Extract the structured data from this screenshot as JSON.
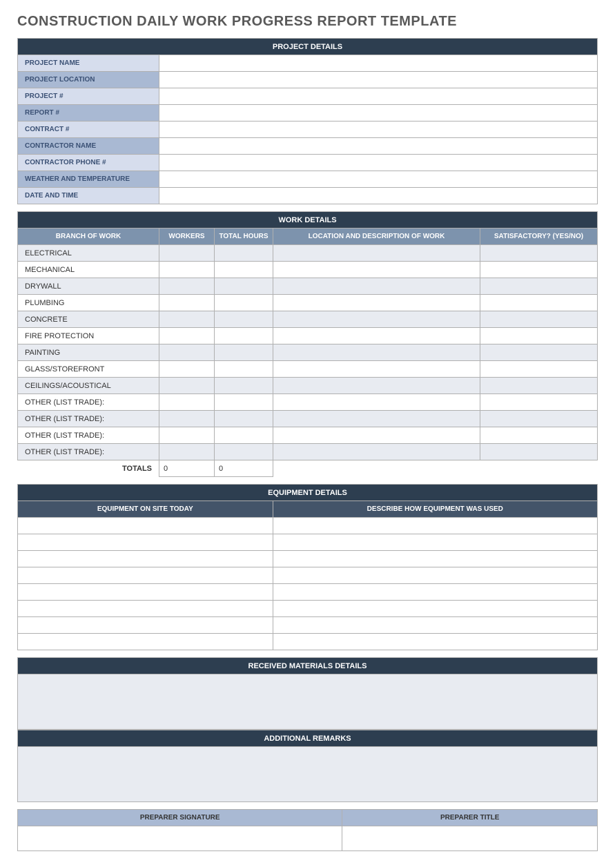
{
  "title": "CONSTRUCTION DAILY WORK PROGRESS REPORT TEMPLATE",
  "sections": {
    "project_details": {
      "header": "PROJECT DETAILS",
      "rows": [
        {
          "label": "PROJECT NAME",
          "value": ""
        },
        {
          "label": "PROJECT LOCATION",
          "value": ""
        },
        {
          "label": "PROJECT #",
          "value": ""
        },
        {
          "label": "REPORT #",
          "value": ""
        },
        {
          "label": "CONTRACT #",
          "value": ""
        },
        {
          "label": "CONTRACTOR NAME",
          "value": ""
        },
        {
          "label": "CONTRACTOR PHONE #",
          "value": ""
        },
        {
          "label": "WEATHER AND TEMPERATURE",
          "value": ""
        },
        {
          "label": "DATE AND TIME",
          "value": ""
        }
      ]
    },
    "work_details": {
      "header": "WORK DETAILS",
      "columns": [
        "BRANCH OF WORK",
        "WORKERS",
        "TOTAL HOURS",
        "LOCATION AND DESCRIPTION OF WORK",
        "SATISFACTORY? (YES/NO)"
      ],
      "rows": [
        {
          "branch": "ELECTRICAL",
          "workers": "",
          "hours": "",
          "location": "",
          "satisfactory": ""
        },
        {
          "branch": "MECHANICAL",
          "workers": "",
          "hours": "",
          "location": "",
          "satisfactory": ""
        },
        {
          "branch": "DRYWALL",
          "workers": "",
          "hours": "",
          "location": "",
          "satisfactory": ""
        },
        {
          "branch": "PLUMBING",
          "workers": "",
          "hours": "",
          "location": "",
          "satisfactory": ""
        },
        {
          "branch": "CONCRETE",
          "workers": "",
          "hours": "",
          "location": "",
          "satisfactory": ""
        },
        {
          "branch": "FIRE PROTECTION",
          "workers": "",
          "hours": "",
          "location": "",
          "satisfactory": ""
        },
        {
          "branch": "PAINTING",
          "workers": "",
          "hours": "",
          "location": "",
          "satisfactory": ""
        },
        {
          "branch": "GLASS/STOREFRONT",
          "workers": "",
          "hours": "",
          "location": "",
          "satisfactory": ""
        },
        {
          "branch": "CEILINGS/ACOUSTICAL",
          "workers": "",
          "hours": "",
          "location": "",
          "satisfactory": ""
        },
        {
          "branch": "OTHER (LIST TRADE):",
          "workers": "",
          "hours": "",
          "location": "",
          "satisfactory": ""
        },
        {
          "branch": "OTHER (LIST TRADE):",
          "workers": "",
          "hours": "",
          "location": "",
          "satisfactory": ""
        },
        {
          "branch": "OTHER (LIST TRADE):",
          "workers": "",
          "hours": "",
          "location": "",
          "satisfactory": ""
        },
        {
          "branch": "OTHER (LIST TRADE):",
          "workers": "",
          "hours": "",
          "location": "",
          "satisfactory": ""
        }
      ],
      "totals_label": "TOTALS",
      "totals_workers": "0",
      "totals_hours": "0"
    },
    "equipment_details": {
      "header": "EQUIPMENT DETAILS",
      "columns": [
        "EQUIPMENT ON SITE TODAY",
        "DESCRIBE HOW EQUIPMENT WAS USED"
      ],
      "rows": [
        {
          "equipment": "",
          "description": ""
        },
        {
          "equipment": "",
          "description": ""
        },
        {
          "equipment": "",
          "description": ""
        },
        {
          "equipment": "",
          "description": ""
        },
        {
          "equipment": "",
          "description": ""
        },
        {
          "equipment": "",
          "description": ""
        },
        {
          "equipment": "",
          "description": ""
        },
        {
          "equipment": "",
          "description": ""
        }
      ]
    },
    "materials": {
      "header": "RECEIVED MATERIALS DETAILS",
      "content": ""
    },
    "remarks": {
      "header": "ADDITIONAL REMARKS",
      "content": ""
    },
    "signature": {
      "col1": "PREPARER SIGNATURE",
      "col2": "PREPARER TITLE",
      "sig": "",
      "title": ""
    }
  }
}
